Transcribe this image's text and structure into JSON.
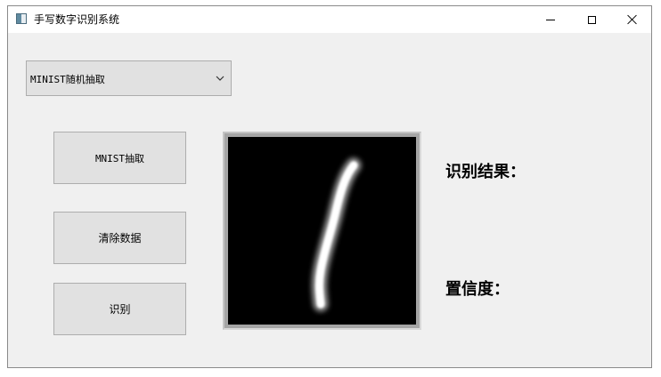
{
  "window": {
    "title": "手写数字识别系统"
  },
  "combo": {
    "selected": "MINIST随机抽取"
  },
  "buttons": {
    "extract": "MNIST抽取",
    "clear": "清除数据",
    "recognize": "识别"
  },
  "results": {
    "result_label": "识别结果：",
    "confidence_label": "置信度："
  },
  "icons": {
    "app": "app-window-icon",
    "minimize": "minimize-icon",
    "maximize": "maximize-icon",
    "close": "close-icon",
    "dropdown": "chevron-down-icon"
  },
  "colors": {
    "window_bg": "#f0f0f0",
    "button_bg": "#e1e1e1",
    "button_border": "#adadad",
    "canvas_bg": "#000000",
    "stroke": "#ffffff"
  }
}
